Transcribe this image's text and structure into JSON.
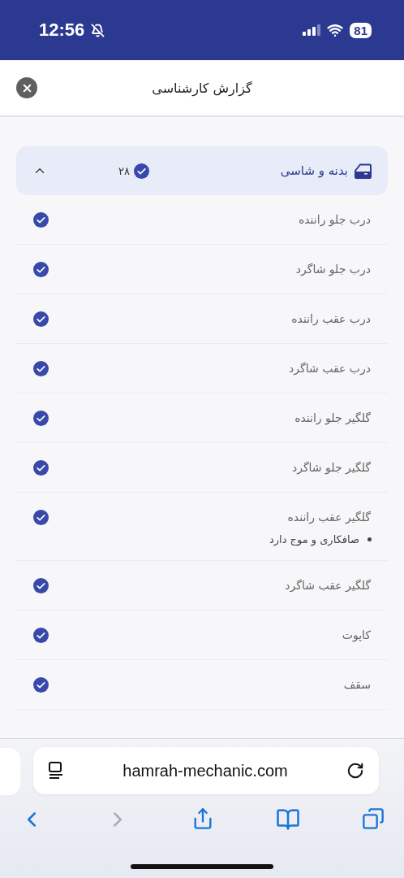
{
  "status_bar": {
    "time": "12:56",
    "silent": true,
    "battery": "81"
  },
  "sheet": {
    "title": "گزارش کارشناسی"
  },
  "section": {
    "title": "بدنه و شاسی",
    "count": "۲۸",
    "expanded": true
  },
  "items": [
    {
      "label": "درب جلو راننده",
      "checked": true
    },
    {
      "label": "درب جلو شاگرد",
      "checked": true
    },
    {
      "label": "درب عقب راننده",
      "checked": true
    },
    {
      "label": "درب عقب شاگرد",
      "checked": true
    },
    {
      "label": "گلگیر جلو راننده",
      "checked": true
    },
    {
      "label": "گلگیر جلو شاگرد",
      "checked": true
    },
    {
      "label": "گلگیر عقب راننده",
      "checked": true,
      "notes": [
        "صافکاری و موج دارد"
      ]
    },
    {
      "label": "گلگیر عقب شاگرد",
      "checked": true
    },
    {
      "label": "کاپوت",
      "checked": true
    },
    {
      "label": "سقف",
      "checked": true
    }
  ],
  "browser": {
    "url": "hamrah-mechanic.com",
    "back_disabled": false,
    "forward_disabled": true
  }
}
